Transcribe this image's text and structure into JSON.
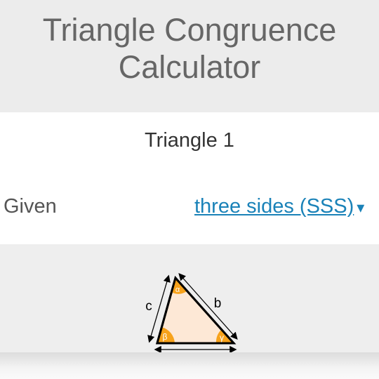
{
  "header": {
    "title": "Triangle Congruence\nCalculator"
  },
  "triangle_section": {
    "title": "Triangle 1",
    "given_label": "Given",
    "given_value": "three sides (SSS)",
    "dropdown_arrow": "▾"
  },
  "diagram": {
    "side_labels": {
      "a": "",
      "b": "b",
      "c": "c"
    },
    "angle_labels": {
      "alpha": "α",
      "beta": "β",
      "gamma": "γ"
    },
    "colors": {
      "fill": "#fde8d6",
      "angle": "#f7a21b",
      "stroke": "#000000"
    }
  }
}
